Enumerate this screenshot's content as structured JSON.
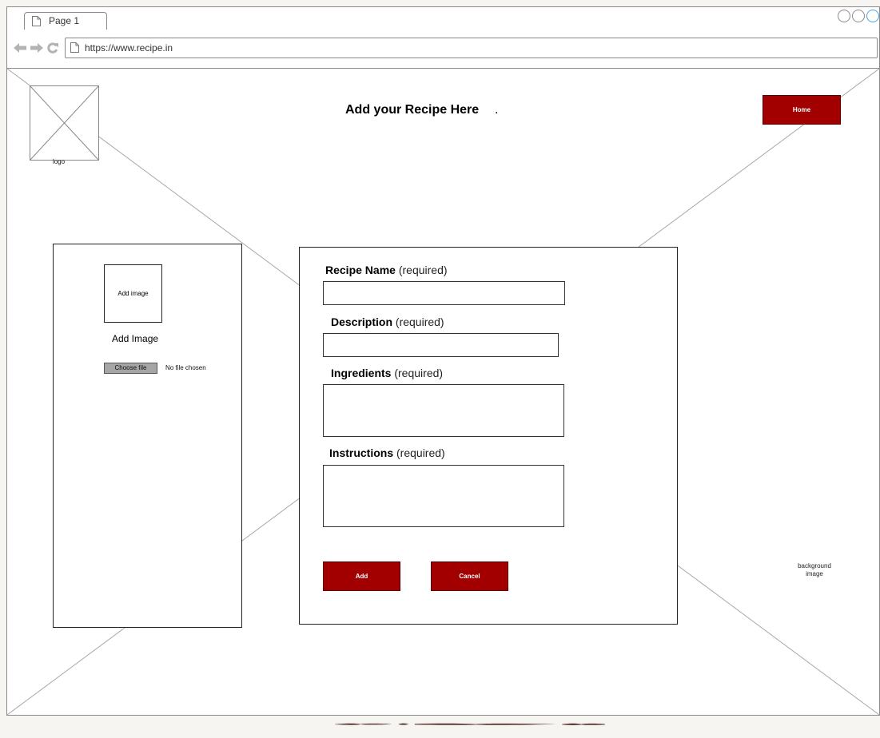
{
  "browser": {
    "tab_title": "Page 1",
    "url": "https://www.recipe.in"
  },
  "header": {
    "logo_caption": "logo",
    "title": "Add your Recipe Here",
    "title_suffix": ".",
    "home_label": "Home"
  },
  "image_panel": {
    "placeholder_text": "Add image",
    "label": "Add Image",
    "choose_file_label": "Choose file",
    "file_status": "No file chosen"
  },
  "form": {
    "fields": [
      {
        "label": "Recipe Name",
        "note": "(required)",
        "value": ""
      },
      {
        "label": "Description",
        "note": "(required)",
        "value": ""
      },
      {
        "label": "Ingredients",
        "note": "(required)",
        "value": ""
      },
      {
        "label": "Instructions",
        "note": "(required)",
        "value": ""
      }
    ],
    "add_label": "Add",
    "cancel_label": "Cancel"
  },
  "background": {
    "caption_line1": "background",
    "caption_line2": "image"
  },
  "colors": {
    "accent": "#a20000",
    "border": "#8a8a8a"
  },
  "icons": [
    "document-icon",
    "back-arrow-icon",
    "forward-arrow-icon",
    "reload-icon"
  ]
}
